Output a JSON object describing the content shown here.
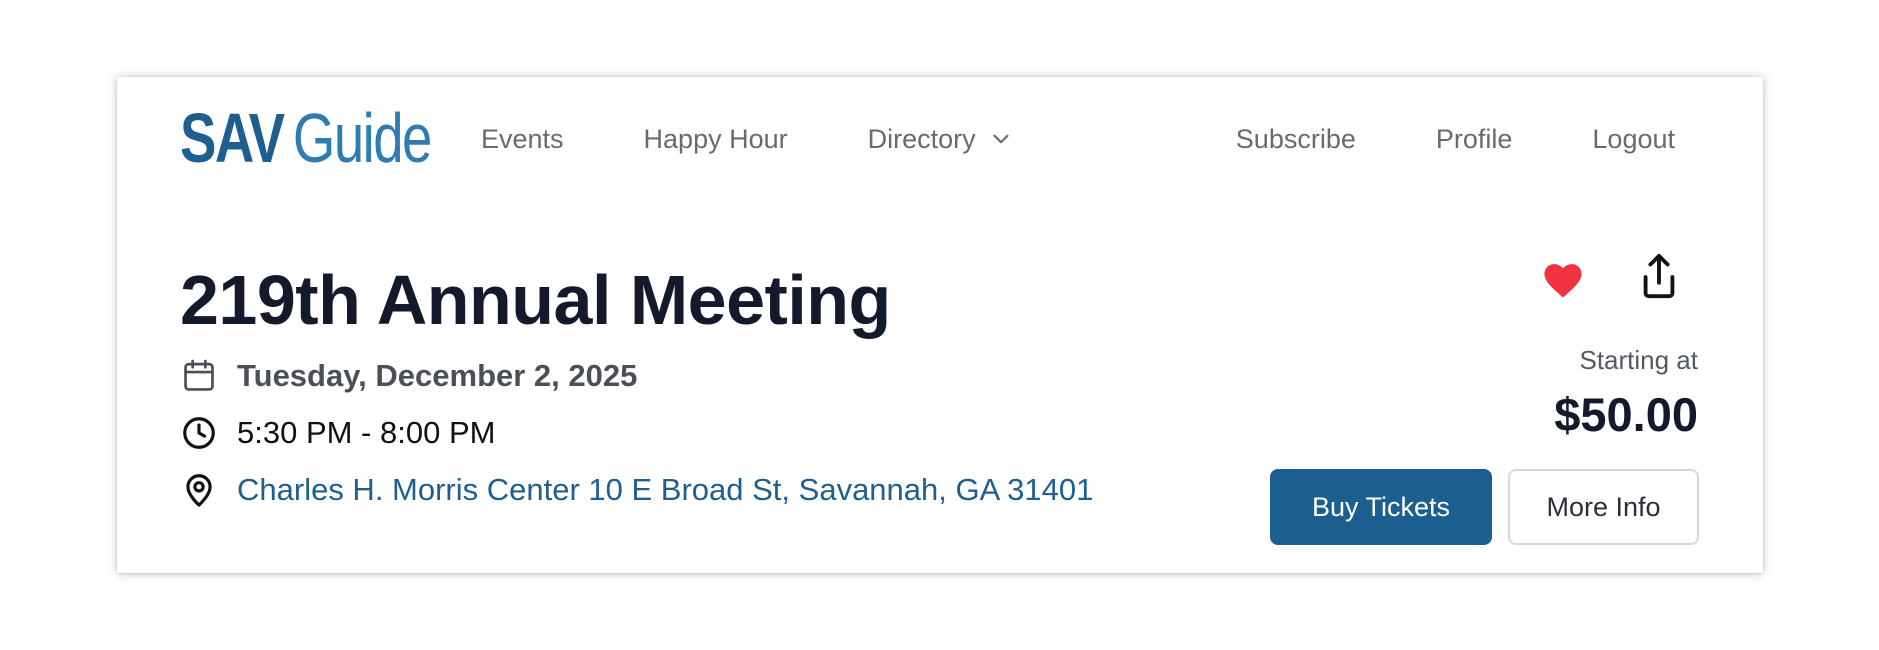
{
  "header": {
    "logo_primary": "SAV",
    "logo_secondary": "Guide",
    "nav_left": [
      "Events",
      "Happy Hour",
      "Directory"
    ],
    "nav_right": [
      "Subscribe",
      "Profile",
      "Logout"
    ]
  },
  "event": {
    "title": "219th Annual Meeting",
    "date": "Tuesday, December 2, 2025",
    "time": "5:30 PM - 8:00 PM",
    "location": "Charles H. Morris Center 10 E Broad St, Savannah, GA 31401"
  },
  "pricing": {
    "label": "Starting at",
    "amount": "$50.00"
  },
  "actions": {
    "buy_label": "Buy Tickets",
    "more_label": "More Info"
  },
  "icons": {
    "favorite": "heart-icon",
    "share": "share-icon",
    "date": "calendar-icon",
    "time": "clock-icon",
    "location": "map-pin-icon",
    "dropdown": "chevron-down-icon"
  },
  "colors": {
    "brand": "#1e5f90",
    "brand_light": "#2f7cb3",
    "heart": "#f0333f",
    "nav_text": "#666b73",
    "title": "#141a2b",
    "link": "#1e5f90"
  }
}
